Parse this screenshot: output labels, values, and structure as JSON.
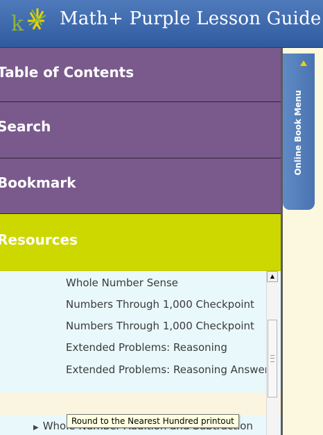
{
  "header": {
    "title": "Math+ Purple Lesson Guide",
    "logo": "k12-logo"
  },
  "menu": {
    "items": [
      {
        "label": "Table of Contents"
      },
      {
        "label": "Search"
      },
      {
        "label": "Bookmark"
      },
      {
        "label": "Resources"
      }
    ]
  },
  "resources": {
    "items": [
      {
        "label": "Whole Number Sense"
      },
      {
        "label": "Numbers Through 1,000 Checkpoint"
      },
      {
        "label": "Numbers Through 1,000 Checkpoint"
      },
      {
        "label": "Extended Problems: Reasoning"
      },
      {
        "label": "Extended Problems: Reasoning Answer Key"
      }
    ],
    "folder": {
      "label": "Whole Number Addition and Subtraction",
      "icon": "triangle-right-icon"
    }
  },
  "tooltip": {
    "text": "Round to the Nearest Hundred printout"
  },
  "side_tab": {
    "label": "Online Book Menu",
    "icon": "triangle-up-icon"
  },
  "colors": {
    "header": "#3b66ab",
    "menu_purple": "#7a5a8d",
    "menu_active": "#cdd800",
    "list_bg": "#e9f8fb",
    "page_bg": "#fbf8df",
    "tab_blue": "#5a83bd"
  }
}
